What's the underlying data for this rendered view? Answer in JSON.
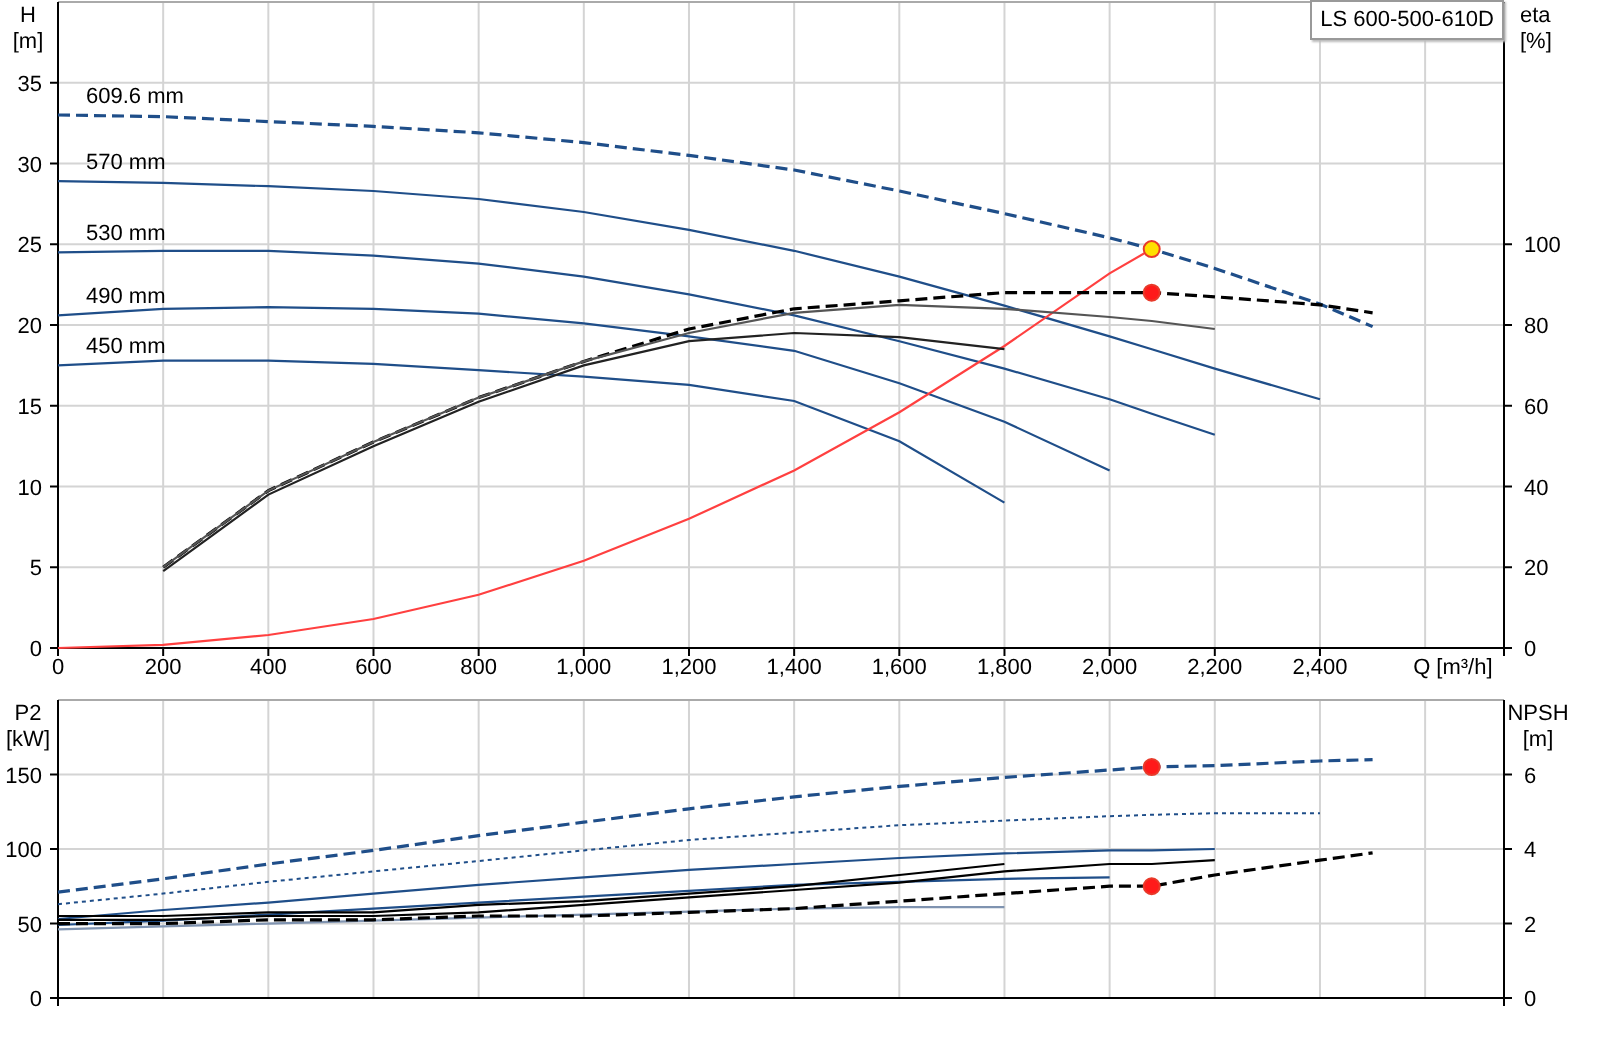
{
  "model_label": "LS 600-500-610D",
  "charts": [
    {
      "chart_data": {
        "type": "line",
        "xlabel": "Q [m³/h]",
        "ylabel": "H\n[m]",
        "grid": true,
        "xlim": [
          0,
          2750
        ],
        "ylim": [
          0,
          40
        ],
        "xticks": [
          {
            "value": 0,
            "label": "0"
          },
          {
            "value": 200,
            "label": "200"
          },
          {
            "value": 400,
            "label": "400"
          },
          {
            "value": 600,
            "label": "600"
          },
          {
            "value": 800,
            "label": "800"
          },
          {
            "value": 1000,
            "label": "1,000"
          },
          {
            "value": 1200,
            "label": "1,200"
          },
          {
            "value": 1400,
            "label": "1,400"
          },
          {
            "value": 1600,
            "label": "1,600"
          },
          {
            "value": 1800,
            "label": "1,800"
          },
          {
            "value": 2000,
            "label": "2,000"
          },
          {
            "value": 2200,
            "label": "2,200"
          },
          {
            "value": 2400,
            "label": "2,400"
          }
        ],
        "yticks": [
          0,
          5,
          10,
          15,
          20,
          25,
          30,
          35
        ],
        "x": [
          0,
          200,
          400,
          600,
          800,
          1000,
          1200,
          1400,
          1600,
          1800,
          2000,
          2080,
          2200,
          2400,
          2500
        ],
        "series": [
          {
            "name": "609.6 mm",
            "line_style": "dashed",
            "color": "#1f4e89",
            "values": [
              33.0,
              32.9,
              32.6,
              32.3,
              31.9,
              31.3,
              30.5,
              29.6,
              28.3,
              26.9,
              25.4,
              24.7,
              23.5,
              21.3,
              19.9
            ]
          },
          {
            "name": "570 mm",
            "line_style": "solid",
            "color": "#1f4e89",
            "values": [
              28.9,
              28.8,
              28.6,
              28.3,
              27.8,
              27.0,
              25.9,
              24.6,
              23.0,
              21.2,
              19.3,
              18.5,
              17.3,
              15.4,
              null
            ]
          },
          {
            "name": "530 mm",
            "line_style": "solid",
            "color": "#1f4e89",
            "values": [
              24.5,
              24.6,
              24.6,
              24.3,
              23.8,
              23.0,
              21.9,
              20.6,
              19.0,
              17.3,
              15.4,
              14.5,
              13.2,
              null,
              null
            ]
          },
          {
            "name": "490 mm",
            "line_style": "solid",
            "color": "#1f4e89",
            "values": [
              20.6,
              21.0,
              21.1,
              21.0,
              20.7,
              20.1,
              19.3,
              18.4,
              16.4,
              14.0,
              11.0,
              null,
              null,
              null,
              null
            ]
          },
          {
            "name": "450 mm",
            "line_style": "solid",
            "color": "#1f4e89",
            "values": [
              17.5,
              17.8,
              17.8,
              17.6,
              17.2,
              16.8,
              16.3,
              15.3,
              12.8,
              9.0,
              null,
              null,
              null,
              null,
              null
            ]
          },
          {
            "line_style": "solid",
            "color": "#ff4040",
            "values": [
              0.0,
              0.2,
              0.8,
              1.8,
              3.3,
              5.4,
              8.0,
              11.0,
              14.6,
              18.7,
              23.2,
              24.7,
              null,
              null,
              null
            ]
          },
          {
            "marker": "circle",
            "color": "#ffe000",
            "values": [
              null,
              null,
              null,
              null,
              null,
              null,
              null,
              null,
              null,
              null,
              null,
              24.7,
              null,
              null,
              null
            ]
          }
        ]
      }
    },
    {
      "chart_data": {
        "type": "line",
        "ylabel": "eta\n[%]",
        "xlim": [
          0,
          2750
        ],
        "ylim": [
          0,
          160
        ],
        "yticks": [
          0,
          20,
          40,
          60,
          80,
          100
        ],
        "x": [
          200,
          400,
          600,
          800,
          1000,
          1200,
          1400,
          1600,
          1800,
          2000,
          2080,
          2200,
          2400,
          2500
        ],
        "series": [
          {
            "line_style": "dashed",
            "color": "#000000",
            "values": [
              20,
              39,
              51,
              62,
              71,
              79,
              84,
              86,
              88,
              88,
              88,
              87,
              85,
              83
            ]
          },
          {
            "line_style": "solid",
            "color": "#555555",
            "values": [
              20,
              39,
              51,
              62,
              71,
              78,
              83,
              85,
              84,
              82,
              81,
              79,
              null,
              null
            ]
          },
          {
            "line_style": "solid",
            "color": "#222222",
            "values": [
              19,
              38,
              50,
              61,
              70,
              76,
              78,
              77,
              74,
              null,
              null,
              null,
              null,
              null
            ]
          },
          {
            "marker": "circle",
            "color": "#ff1a1a",
            "values": [
              null,
              null,
              null,
              null,
              null,
              null,
              null,
              null,
              null,
              null,
              88,
              null,
              null,
              null
            ]
          }
        ]
      }
    },
    {
      "chart_data": {
        "type": "line",
        "ylabel": "P2\n[kW]",
        "grid": true,
        "xlim": [
          0,
          2750
        ],
        "ylim": [
          0,
          200
        ],
        "yticks": [
          0,
          50,
          100,
          150
        ],
        "x": [
          0,
          200,
          400,
          600,
          800,
          1000,
          1200,
          1400,
          1600,
          1800,
          2000,
          2080,
          2200,
          2400,
          2500
        ],
        "series": [
          {
            "line_style": "dashed",
            "color": "#1f4e89",
            "values": [
              71,
              80,
              90,
              99,
              109,
              118,
              127,
              135,
              142,
              148,
              153,
              155,
              156,
              159,
              160
            ]
          },
          {
            "line_style": "dotted",
            "color": "#1f4e89",
            "values": [
              63,
              70,
              78,
              85,
              92,
              99,
              106,
              111,
              116,
              119,
              122,
              123,
              124,
              124,
              null
            ]
          },
          {
            "line_style": "solid",
            "color": "#1f4e89",
            "values": [
              53,
              59,
              64,
              70,
              76,
              81,
              86,
              90,
              94,
              97,
              99,
              99,
              100,
              null,
              null
            ]
          },
          {
            "line_style": "solid",
            "color": "#1f4e89",
            "values": [
              49,
              52,
              56,
              60,
              64,
              68,
              72,
              76,
              78,
              80,
              81,
              null,
              null,
              null,
              null
            ]
          },
          {
            "line_style": "solid",
            "color": "#7f93b0",
            "values": [
              46,
              48,
              50,
              52,
              54,
              56,
              58,
              60,
              61,
              61,
              null,
              null,
              null,
              null,
              null
            ]
          },
          {
            "marker": "circle",
            "color": "#ff1a1a",
            "values": [
              null,
              null,
              null,
              null,
              null,
              null,
              null,
              null,
              null,
              null,
              null,
              155,
              null,
              null,
              null
            ]
          }
        ]
      }
    },
    {
      "chart_data": {
        "type": "line",
        "ylabel": "NPSH\n[m]",
        "xlim": [
          0,
          2750
        ],
        "ylim": [
          0,
          8
        ],
        "yticks": [
          0,
          2,
          4,
          6
        ],
        "x": [
          0,
          200,
          400,
          600,
          800,
          1000,
          1200,
          1400,
          1600,
          1800,
          2000,
          2080,
          2200,
          2400,
          2500
        ],
        "series": [
          {
            "line_style": "dashed",
            "color": "#000000",
            "values": [
              2.0,
              2.0,
              2.1,
              2.1,
              2.2,
              2.2,
              2.3,
              2.4,
              2.6,
              2.8,
              3.0,
              3.0,
              3.3,
              3.7,
              3.9
            ]
          },
          {
            "line_style": "solid",
            "color": "#000000",
            "values": [
              2.1,
              2.1,
              2.2,
              2.2,
              2.3,
              2.5,
              2.7,
              2.9,
              3.1,
              3.4,
              3.6,
              3.6,
              3.7,
              null,
              null
            ]
          },
          {
            "line_style": "solid",
            "color": "#000000",
            "values": [
              2.2,
              2.2,
              2.3,
              2.3,
              2.5,
              2.6,
              2.8,
              3.0,
              3.3,
              3.6,
              null,
              null,
              null,
              null,
              null
            ]
          },
          {
            "marker": "circle",
            "color": "#ff1a1a",
            "values": [
              null,
              null,
              null,
              null,
              null,
              null,
              null,
              null,
              null,
              null,
              null,
              3.0,
              null,
              null,
              null
            ]
          }
        ]
      }
    }
  ]
}
